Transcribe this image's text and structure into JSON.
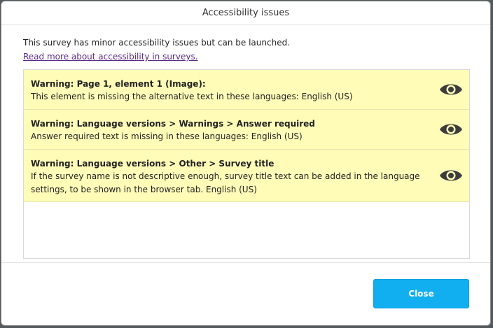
{
  "dialog": {
    "title": "Accessibility issues",
    "intro": "This survey has minor accessibility issues but can be launched.",
    "read_more": "Read more about accessibility in surveys."
  },
  "issues": [
    {
      "title": "Warning: Page 1, element 1 (Image):",
      "text": "This element is missing the alternative text in these languages: English (US)",
      "icon": "eye-icon"
    },
    {
      "title": "Warning: Language versions > Warnings > Answer required",
      "text": "Answer required text is missing in these languages: English (US)",
      "icon": "eye-icon"
    },
    {
      "title": "Warning: Language versions > Other > Survey title",
      "text": "If the survey name is not descriptive enough, survey title text can be added in the language settings, to be shown in the browser tab. English (US)",
      "icon": "eye-icon"
    }
  ],
  "footer": {
    "close_label": "Close"
  },
  "colors": {
    "warning_background": "#fffcb8",
    "primary_button": "#11aef0",
    "link": "#5b2a86"
  }
}
